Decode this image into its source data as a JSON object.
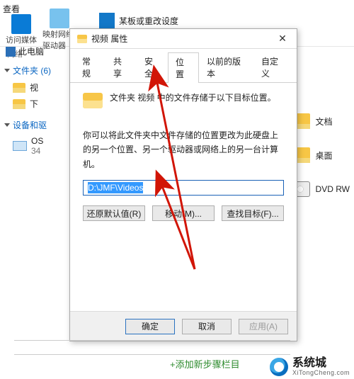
{
  "explorer": {
    "view_label": "查看",
    "ribbon_closed": "某板或重改设度",
    "ribbon_items": [
      "访问媒体",
      "映射网络驱动器"
    ],
    "section_network": "网络",
    "breadcrumb": "此电脑",
    "tree_folders_header": "文件夹 (6)",
    "tree_item_video": "视",
    "tree_item_download": "下",
    "tree_devices_header": "设备和驱",
    "drive_os": "OS",
    "drive_num": "34",
    "right_doc": "文档",
    "right_desktop": "桌面",
    "right_dvd": "DVD RW"
  },
  "dialog": {
    "title": "视频 属性",
    "tabs": [
      "常规",
      "共享",
      "安全",
      "位置",
      "以前的版本",
      "自定义"
    ],
    "active_tab_index": 3,
    "desc": "文件夹 视频 中的文件存储于以下目标位置。",
    "hint": "你可以将此文件夹中文件存储的位置更改为此硬盘上的另一个位置、另一个驱动器或网络上的另一台计算机。",
    "path_value": "D:\\JMF\\Videos",
    "btn_restore": "还原默认值(R)",
    "btn_move": "移动(M)...",
    "btn_find": "查找目标(F)...",
    "btn_ok": "确定",
    "btn_cancel": "取消",
    "btn_apply": "应用(A)"
  },
  "overlay": {
    "add_step": "+添加新步骤栏目"
  },
  "watermark": {
    "name": "系统城",
    "url": "XiTongCheng.com"
  },
  "arrow_color": "#d11507"
}
